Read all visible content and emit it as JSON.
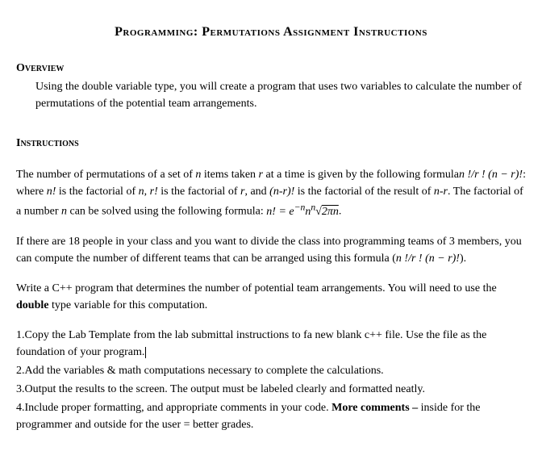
{
  "title": "Programming: Permutations Assignment Instructions",
  "overview": {
    "header": "Overview",
    "body": "Using the double variable type, you will create a program that uses two variables to calculate the number of permutations of the potential team arrangements."
  },
  "instructions": {
    "header": "Instructions",
    "p1_a": "The number of permutations of a set of ",
    "p1_n1": "n",
    "p1_b": " items taken ",
    "p1_r1": "r",
    "p1_c": " at a time is given by the following formula",
    "p1_formula1": "n !/r ! (n − r)!",
    "p1_d": ": where ",
    "p1_nf": "n!",
    "p1_e": " is the factorial of ",
    "p1_n2": "n",
    "p1_f": ", ",
    "p1_rf": "r!",
    "p1_g": " is the factorial of ",
    "p1_r2": "r",
    "p1_h": ", and ",
    "p1_nrf": "(n-r)!",
    "p1_i": " is the factorial of the result of ",
    "p1_nr": "n-r",
    "p1_j": ". The factorial of a number ",
    "p1_n3": "n",
    "p1_k": " can be solved using the following formula: ",
    "p1_formula2_a": "n! = e",
    "p1_formula2_sup": "−n",
    "p1_formula2_b": "n",
    "p1_formula2_b_sup": "n",
    "p1_formula2_root": "√",
    "p1_formula2_rad": "2πn",
    "p1_end": ".",
    "p2_a": "If there are 18 people in your class and you want to divide the class into programming teams of 3 members, you can compute the number of different teams that can be arranged using this formula (",
    "p2_formula": "n !/r ! (n − r)!",
    "p2_b": ").",
    "p3_a": "Write a C++ program that determines the number of potential team arrangements. You will need to use the ",
    "p3_bold": "double",
    "p3_b": " type variable for this computation.",
    "item1_num": "1.  ",
    "item1_a": "Copy the Lab Template from the lab submittal instructions to fa new blank c++ file.  Use the file as the foundation of your program.",
    "item2_num": "2.  ",
    "item2": "Add the variables & math computations necessary to complete the calculations.",
    "item3_num": "3.  ",
    "item3": "Output the results to the screen. The output must be labeled clearly and formatted neatly.",
    "item4_num": "4.  ",
    "item4_a": "Include proper formatting, and appropriate comments in your code.   ",
    "item4_bold": "More comments –",
    "item4_b": " inside for the programmer and outside for the user = better grades."
  }
}
